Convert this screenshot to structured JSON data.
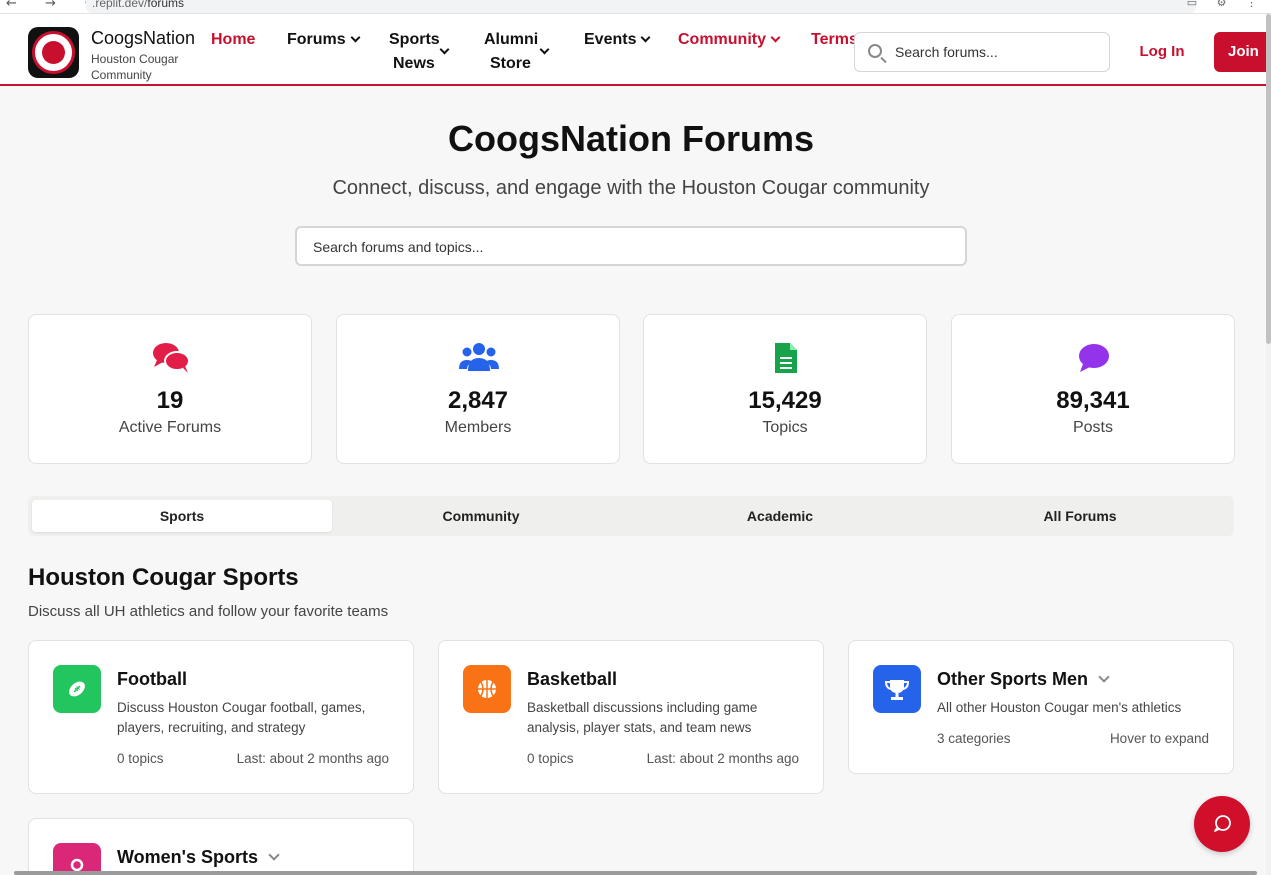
{
  "browser": {
    "nav_glyphs": "← → ↻",
    "url_prefix": ".replit.dev/",
    "url_path": "forums"
  },
  "header": {
    "brand_name": "CoogsNation",
    "brand_subtitle": "Houston Cougar Community",
    "nav": {
      "home": "Home",
      "forums": "Forums",
      "sports_news_1": "Sports",
      "sports_news_2": "News",
      "alumni_store_1": "Alumni",
      "alumni_store_2": "Store",
      "events": "Events",
      "community": "Community",
      "terms": "Terms"
    },
    "search_placeholder": "Search forums...",
    "login_label": "Log In",
    "join_label": "Join"
  },
  "hero": {
    "title": "CoogsNation Forums",
    "subtitle": "Connect, discuss, and engage with the Houston Cougar community",
    "search_placeholder": "Search forums and topics..."
  },
  "stats": [
    {
      "value": "19",
      "label": "Active Forums",
      "icon": "chat-bubbles-icon",
      "color": "#e11d48"
    },
    {
      "value": "2,847",
      "label": "Members",
      "icon": "users-icon",
      "color": "#2563eb"
    },
    {
      "value": "15,429",
      "label": "Topics",
      "icon": "document-icon",
      "color": "#16a34a"
    },
    {
      "value": "89,341",
      "label": "Posts",
      "icon": "comment-icon",
      "color": "#9333ea"
    }
  ],
  "tabs": [
    {
      "label": "Sports",
      "active": true
    },
    {
      "label": "Community",
      "active": false
    },
    {
      "label": "Academic",
      "active": false
    },
    {
      "label": "All Forums",
      "active": false
    }
  ],
  "section": {
    "title": "Houston Cougar Sports",
    "subtitle": "Discuss all UH athletics and follow your favorite teams"
  },
  "forums": [
    {
      "title": "Football",
      "description": "Discuss Houston Cougar football, games, players, recruiting, and strategy",
      "meta_left": "0 topics",
      "meta_right": "Last: about 2 months ago",
      "icon": "football-icon",
      "color": "#22c55e"
    },
    {
      "title": "Basketball",
      "description": "Basketball discussions including game analysis, player stats, and team news",
      "meta_left": "0 topics",
      "meta_right": "Last: about 2 months ago",
      "icon": "basketball-icon",
      "color": "#f97316"
    },
    {
      "title": "Other Sports Men",
      "description": "All other Houston Cougar men's athletics",
      "meta_left": "3 categories",
      "meta_right": "Hover to expand",
      "icon": "trophy-icon",
      "color": "#2563eb"
    },
    {
      "title": "Women's Sports",
      "icon": "female-icon",
      "color": "#db2777"
    }
  ]
}
